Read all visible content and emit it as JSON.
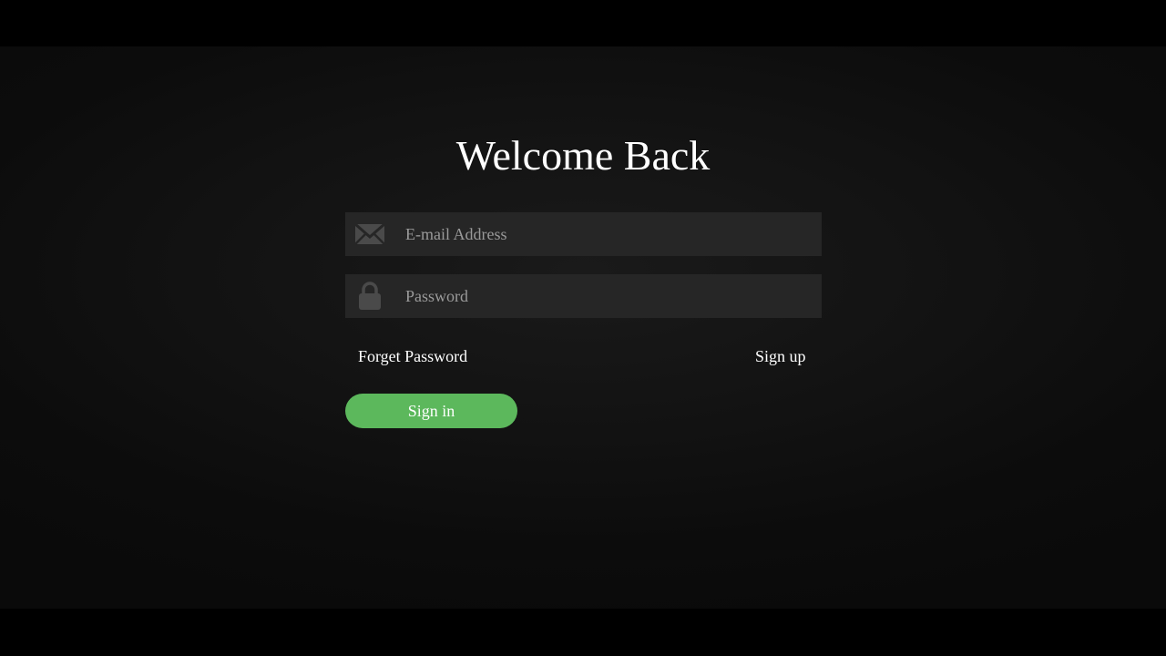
{
  "login": {
    "title": "Welcome Back",
    "email": {
      "icon": "envelope-icon",
      "placeholder": "E-mail Address",
      "value": ""
    },
    "password": {
      "icon": "lock-icon",
      "placeholder": "Password",
      "value": ""
    },
    "forgot_label": "Forget Password",
    "signup_label": "Sign up",
    "signin_label": "Sign in"
  },
  "colors": {
    "background": "#111111",
    "field_bg": "#262626",
    "icon": "#4a4a4a",
    "accent": "#5cb85c",
    "text": "#ffffff"
  }
}
